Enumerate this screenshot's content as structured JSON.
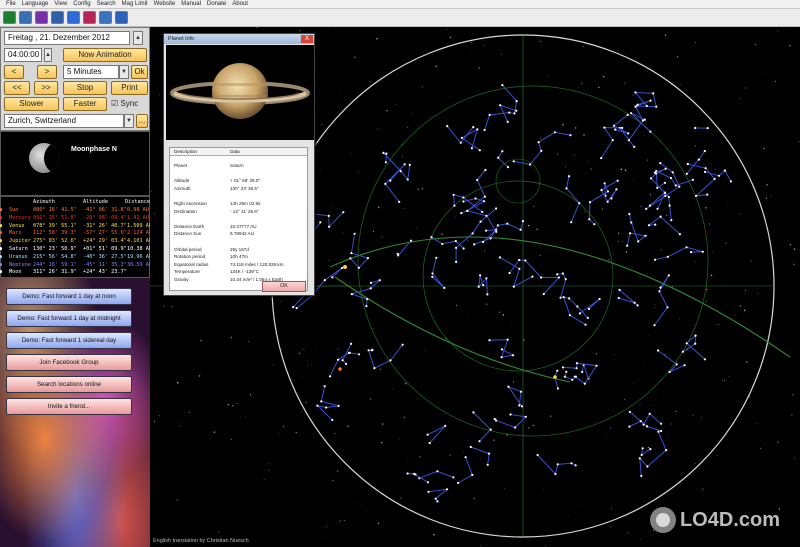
{
  "menu": [
    "File",
    "Language",
    "View",
    "Config",
    "Search",
    "Mag Limit",
    "Website",
    "Manual",
    "Donate",
    "About"
  ],
  "toolbar": [
    {
      "icon": "green-square-icon",
      "color": "#1a7f2e"
    },
    {
      "icon": "image-icon",
      "color": "#3b6fb5"
    },
    {
      "icon": "palette-icon",
      "color": "#7a2fa8"
    },
    {
      "icon": "monitor-icon",
      "color": "#2e5fa8"
    },
    {
      "icon": "cloud-icon",
      "color": "#2f6bd6"
    },
    {
      "icon": "heart-icon",
      "color": "#b6245c"
    },
    {
      "icon": "world-icon",
      "color": "#3a73c0"
    },
    {
      "icon": "help-icon",
      "color": "#2d62b8"
    }
  ],
  "controls": {
    "date": "Freitag  , 21. Dezember 2012",
    "time": "04:00:00",
    "now_animation": "Now Animation",
    "back_button": "<",
    "forward_button": ">",
    "fast_back_button": "<<",
    "fast_forward_button": ">>",
    "step": "5 Minutes",
    "ok": "Ok",
    "stop": "Stop",
    "print": "Print",
    "slower": "Slower",
    "faster": "Faster",
    "sync": "Sync",
    "location": "Zurich, Switzerland",
    "more": "..."
  },
  "moon": {
    "label": "Moonphase  N"
  },
  "planets": {
    "headers": [
      "Azimuth",
      "Altitude",
      "Distance"
    ],
    "rows": [
      {
        "name": "Sun",
        "az": "080° 16' 41.5\"",
        "alt": "-41° 06' 31.8\"",
        "dist": "0.98 AU",
        "color": "#ff7a22"
      },
      {
        "name": "Mercury",
        "az": "091° 15' 51.8\"",
        "alt": "-29° 08' 09.4\"",
        "dist": "1.42 AU",
        "color": "#e03434"
      },
      {
        "name": "Venus",
        "az": "078° 39' 55.1\"",
        "alt": "-31° 26' 40.7\"",
        "dist": "1.509 AU",
        "color": "#f0e050"
      },
      {
        "name": "Mars",
        "az": "112° 58' 39.3\"",
        "alt": "-57° 27' 55.6\"",
        "dist": "2.124 AU",
        "color": "#ff5a3c"
      },
      {
        "name": "Jupiter",
        "az": "275° 03' 52.6\"",
        "alt": "+24° 29' 03.4\"",
        "dist": "4.101 AU",
        "color": "#ffd24a"
      },
      {
        "name": "Saturn",
        "az": "130° 23' 50.9\"",
        "alt": "+01° 51' 09.9\"",
        "dist": "10.38 AU",
        "color": "#ffffff"
      },
      {
        "name": "Uranus",
        "az": "215° 56' 54.8\"",
        "alt": "-40° 36' 27.5\"",
        "dist": "19.96 AU",
        "color": "#9fe0ff"
      },
      {
        "name": "Neptune",
        "az": "244° 16' 59.1\"",
        "alt": "-45° 11' 35.3\"",
        "dist": "30.59 AU",
        "color": "#8080ff"
      },
      {
        "name": "Moon",
        "az": "311° 26' 31.9\"",
        "alt": "+24° 43' 23.7\"",
        "dist": "",
        "color": "#ffffff"
      }
    ]
  },
  "demo": [
    {
      "label": "Demo: Fast forward 1 day at noon",
      "style": "blue"
    },
    {
      "label": "Demo: Fast forward 1 day at midnight",
      "style": "blue"
    },
    {
      "label": "Demo: Fast forward 1 sidereal day",
      "style": "blue"
    },
    {
      "label": "Join Facebook Group",
      "style": "pink"
    },
    {
      "label": "Search locations online",
      "style": "pink"
    },
    {
      "label": "Invite a friend...",
      "style": "pink"
    }
  ],
  "dialog": {
    "title": "Planet Info",
    "close": "X",
    "col_desc": "Description",
    "col_data": "Data",
    "rows": [
      {
        "d": "Planet",
        "v": "Saturn"
      },
      {
        "d": "",
        "v": ""
      },
      {
        "d": "Altitude",
        "v": "+ 01° 56' 29.0\""
      },
      {
        "d": "Azimuth",
        "v": "130° 23' 36.5\""
      },
      {
        "d": "",
        "v": ""
      },
      {
        "d": "Right Ascension",
        "v": "14h 29m 02.9s"
      },
      {
        "d": "Declination",
        "v": "- 12° 11' 26.6\""
      },
      {
        "d": "",
        "v": ""
      },
      {
        "d": "Distance Earth",
        "v": "10.37777 AU"
      },
      {
        "d": "Distance Sun",
        "v": "9.78942 AU"
      },
      {
        "d": "",
        "v": ""
      },
      {
        "d": "Orbital period",
        "v": "29y 167d"
      },
      {
        "d": "Rotation period",
        "v": "10h 47m"
      },
      {
        "d": "Equatorial radius",
        "v": "74.118 miles / 120.536 km"
      },
      {
        "d": "Temperature",
        "v": "134K / -139°C"
      },
      {
        "d": "Gravity",
        "v": "10.44 m/s² / 1.064 x Earth"
      }
    ],
    "ok": "OK"
  },
  "credit": "English translation by Christian Nuesch",
  "watermark": "LO4D.com"
}
